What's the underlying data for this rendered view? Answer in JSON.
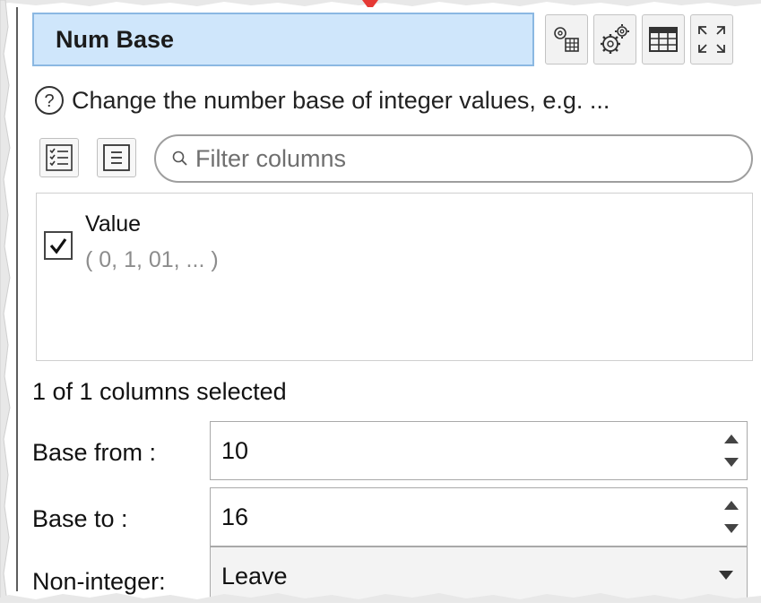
{
  "panel": {
    "title": "Num Base",
    "toolbar": [
      {
        "icon": "calculator-gear-icon"
      },
      {
        "icon": "gears-icon"
      },
      {
        "icon": "table-icon"
      },
      {
        "icon": "expand-icon"
      }
    ]
  },
  "help": {
    "icon": "help-circle-icon",
    "text": "Change the number base of integer values, e.g. ..."
  },
  "column_tools": {
    "select_all_icon": "checklist-icon",
    "list_icon": "list-icon",
    "filter_placeholder": "Filter columns"
  },
  "columns": [
    {
      "name": "Value",
      "sample": "( 0, 1, 01, ... )",
      "checked": true
    }
  ],
  "status": "1 of 1 columns selected",
  "fields": {
    "base_from": {
      "label": "Base from :",
      "value": "10"
    },
    "base_to": {
      "label": "Base to :",
      "value": "16"
    },
    "non_integer": {
      "label": "Non-integer:",
      "value": "Leave"
    }
  },
  "colors": {
    "title_bg": "#cfe6fb",
    "accent_arrow": "#e53935"
  }
}
